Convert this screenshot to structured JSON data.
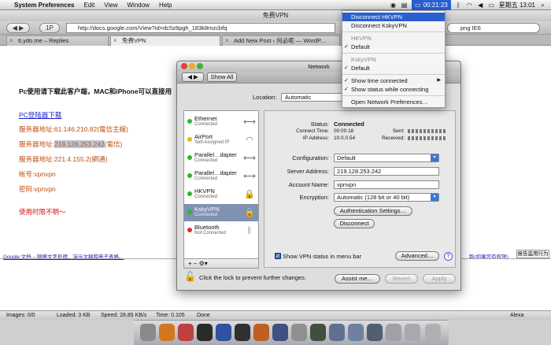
{
  "menubar": {
    "app": "System Preferences",
    "items": [
      "Edit",
      "View",
      "Window",
      "Help"
    ],
    "vpn_time": "00:21:23",
    "clock": "星期五 13:01"
  },
  "browser": {
    "title": "免费VPN",
    "url": "http://docs.google.com/View?id=dc5z8pgh_183k8mzcbfq",
    "bookmark": "1P",
    "search": "png  IE6",
    "tabs": [
      "tt.ydo.me – Replies",
      "免费VPN",
      "Add New Post ‹ 何必呢 — WordP..."
    ],
    "content": {
      "intro": "Pc使用请下载此客户端，MAC和iPhone可以直接用",
      "download_link": "PC登陆器下载",
      "server1": "服务器地址:61.146.210.82(電信主線)",
      "server2_prefix": "服务器地址:",
      "server2_ip": "219.128.253.242",
      "server2_suffix": "(電信)",
      "server3": "服务器地址:221.4.155.2(網通)",
      "account": "帐号:vpnvpn",
      "password": "密码:vpnvpn",
      "note": "使用时限不明～",
      "gdocs_footer": "Google 文档 – 网络文字处理、演示文稿和电子表格。",
      "gdocs_right": "取(如果您有权限)",
      "report_button": "报告滥用行为"
    },
    "status": {
      "images": "Images: 0/0",
      "loaded": "Loaded: 3 KB",
      "speed": "Speed: 28.85 KB/s",
      "time": "Time: 0.105",
      "state": "Done",
      "addon": "Alexa"
    }
  },
  "network": {
    "title": "Network",
    "show_all": "Show All",
    "location_label": "Location:",
    "location_value": "Automatic",
    "services": [
      {
        "name": "Ethernet",
        "status": "Connected",
        "dot": "#2fb52f",
        "icon": "⟷"
      },
      {
        "name": "AirPort",
        "status": "Self-Assigned IP",
        "dot": "#e8b81a",
        "icon": "◠"
      },
      {
        "name": "Parallel…dapter",
        "status": "Connected",
        "dot": "#2fb52f",
        "icon": "⟷"
      },
      {
        "name": "Parallel…dapter",
        "status": "Connected",
        "dot": "#2fb52f",
        "icon": "⟷"
      },
      {
        "name": "HKVPN",
        "status": "Connected",
        "dot": "#2fb52f",
        "icon": "🔒"
      },
      {
        "name": "KskyVPN",
        "status": "Connected",
        "dot": "#2fb52f",
        "icon": "🔒"
      },
      {
        "name": "Bluetooth",
        "status": "Not Connected",
        "dot": "#d83030",
        "icon": "ᛒ"
      }
    ],
    "status_label": "Status:",
    "status_value": "Connected",
    "connect_time_label": "Connect Time:",
    "connect_time": "00:00:18",
    "ip_label": "IP Address:",
    "ip": "10.0.0.54",
    "sent_label": "Sent:",
    "received_label": "Received:",
    "configuration_label": "Configuration:",
    "configuration": "Default",
    "server_label": "Server Address:",
    "server": "219.128.253.242",
    "account_label": "Account Name:",
    "account": "vpnvpn",
    "encryption_label": "Encryption:",
    "encryption": "Automatic (128 bit or 40 bit)",
    "auth_button": "Authentication Settings…",
    "disconnect_button": "Disconnect",
    "show_status_label": "Show VPN status in menu bar",
    "advanced_button": "Advanced…",
    "help": "?",
    "lock_text": "Click the lock to prevent further changes.",
    "assist_button": "Assist me…",
    "revert_button": "Revert",
    "apply_button": "Apply",
    "list_controls": "+  –  ⚙▾"
  },
  "vpn_menu": {
    "disconnect_hk": "Disconnect HKVPN",
    "disconnect_ksky": "Disconnect KskyVPN",
    "hk_header": "HKVPN",
    "hk_default": "Default",
    "ksky_header": "KskyVPN",
    "ksky_default": "Default",
    "show_time": "Show time connected",
    "show_status": "Show status while connecting",
    "open_prefs": "Open Network Preferences…"
  }
}
